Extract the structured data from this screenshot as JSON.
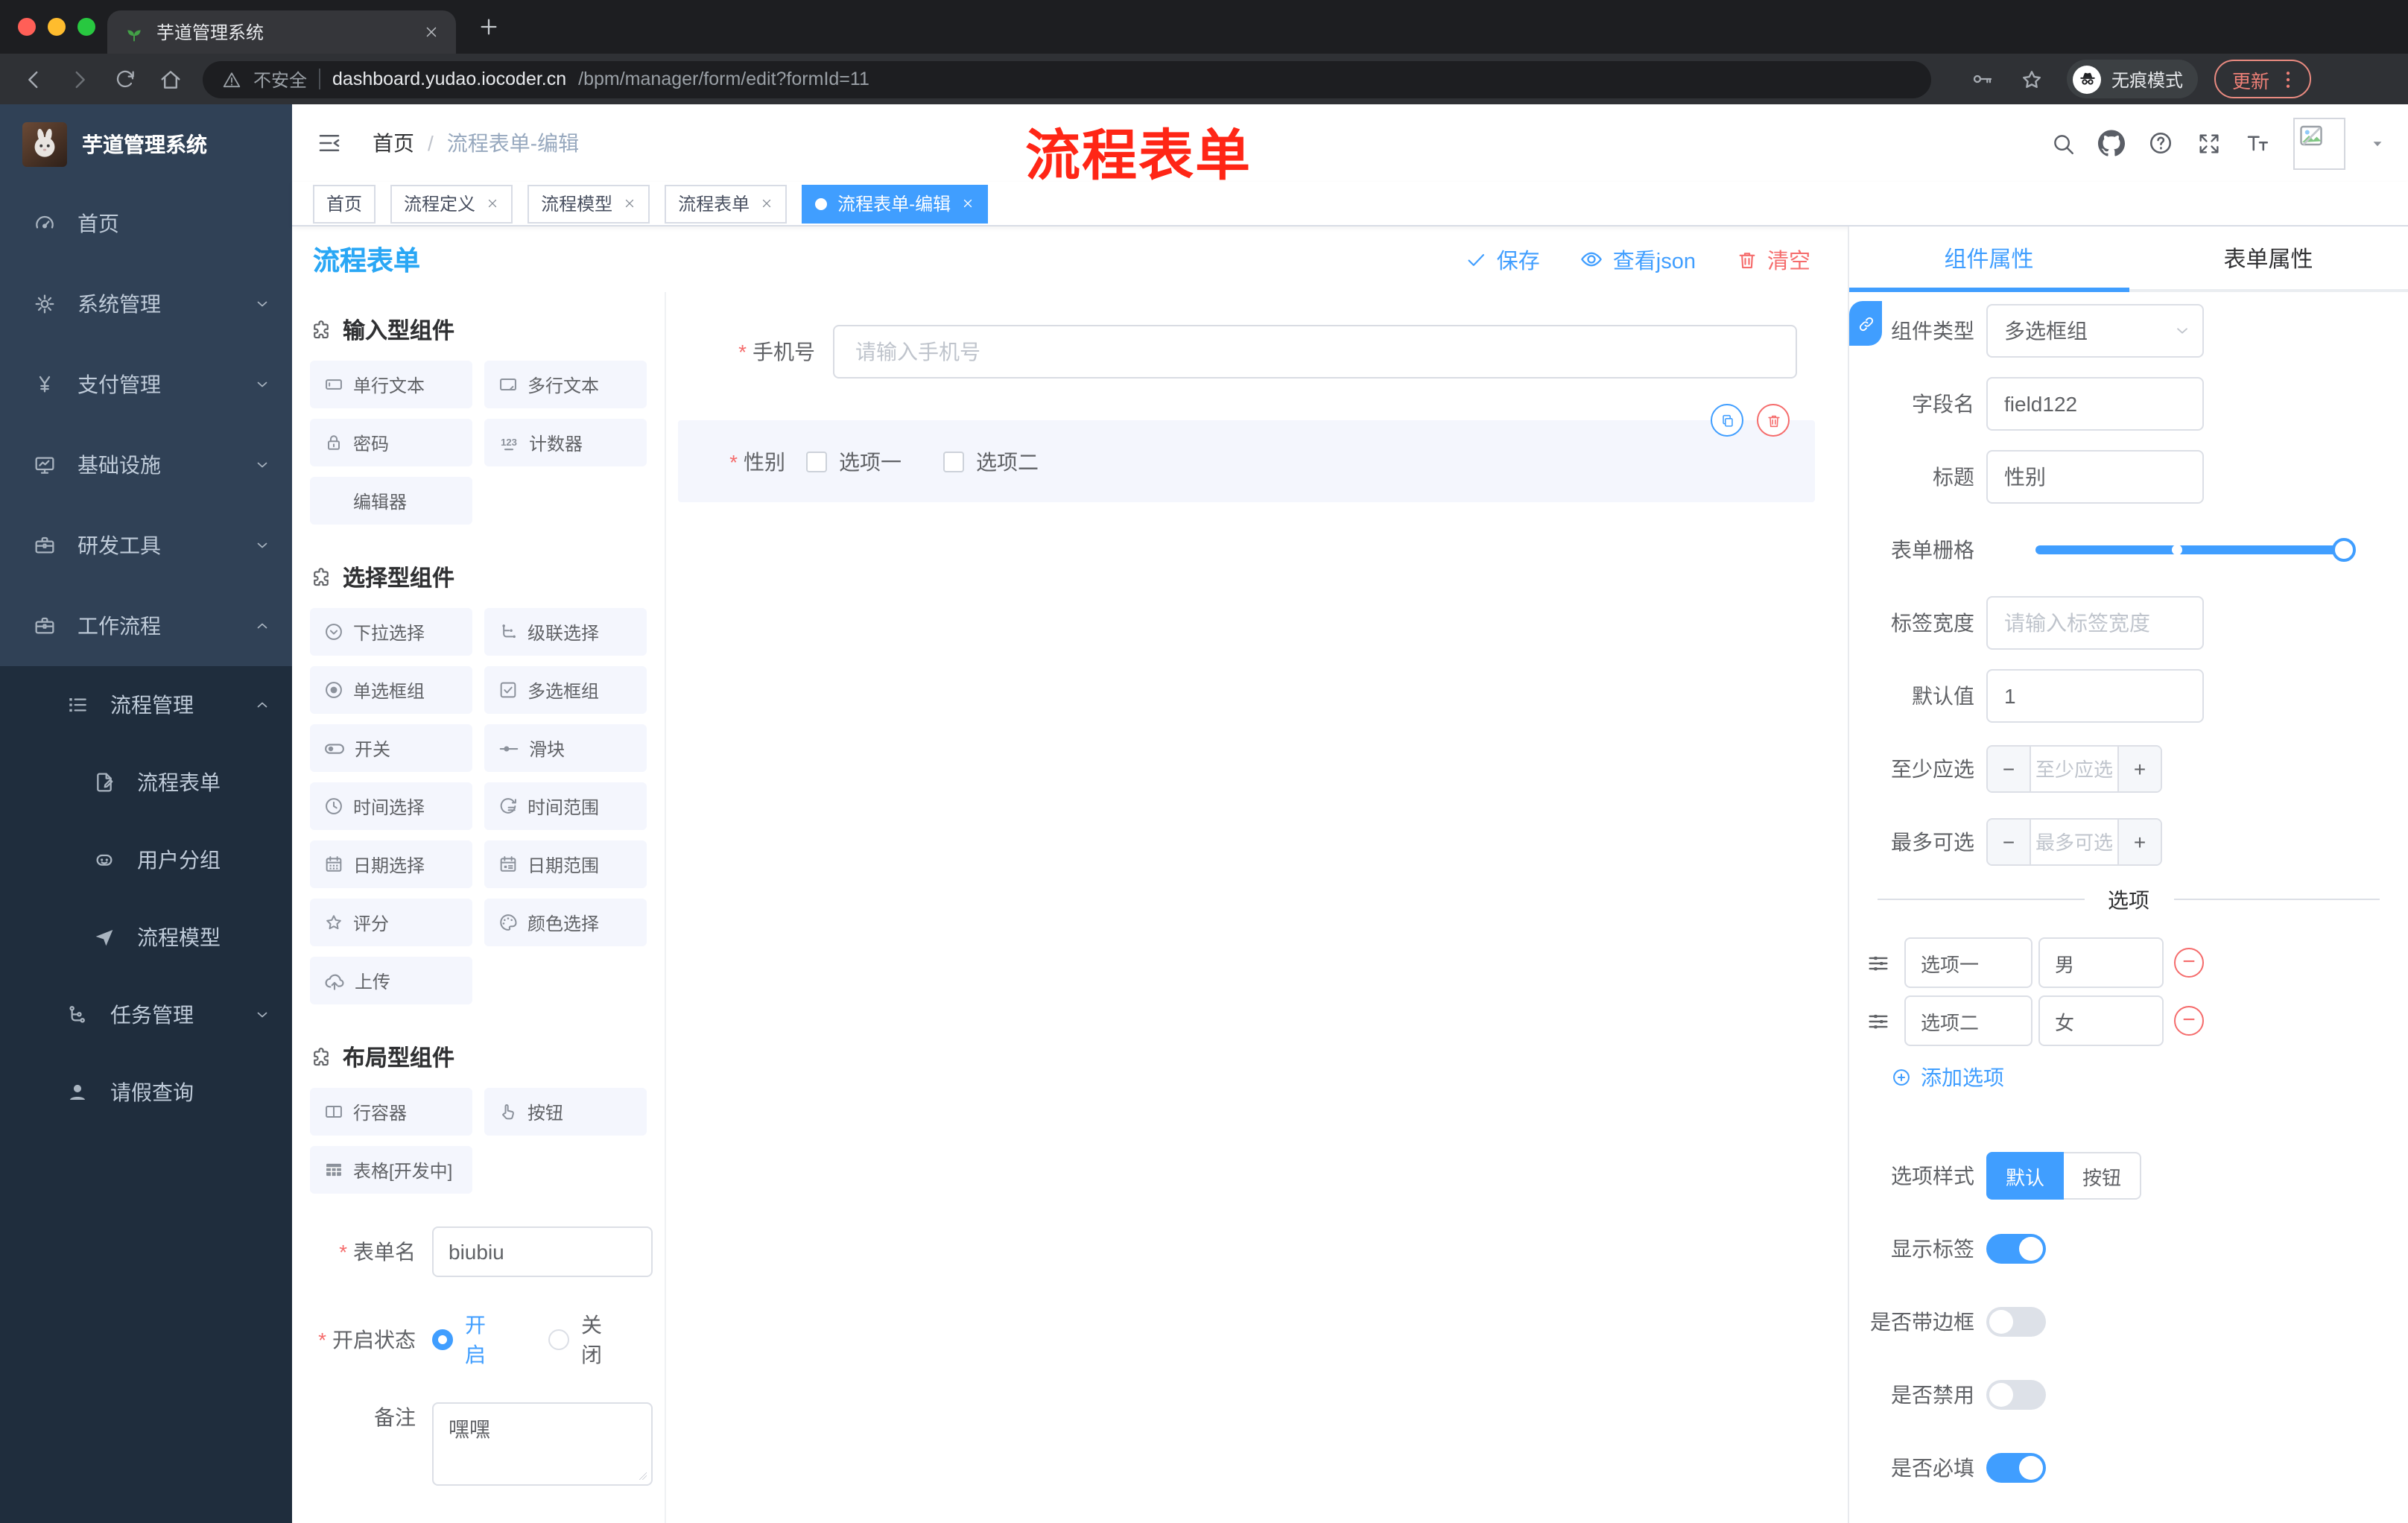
{
  "colors": {
    "accent": "#409eff",
    "danger": "#f56c6c",
    "title_blue": "#2aa7f5",
    "sidebar_bg": "#304156",
    "submenu_bg": "#1f2d3d",
    "annotation_red": "#ff2616"
  },
  "browser": {
    "tab_title": "芋道管理系统",
    "security_label": "不安全",
    "url_host": "dashboard.yudao.iocoder.cn",
    "url_path": "/bpm/manager/form/edit?formId=11",
    "incognito_label": "无痕模式",
    "update_label": "更新"
  },
  "appbar": {
    "breadcrumb_home": "首页",
    "breadcrumb_separator": "/",
    "breadcrumb_current": "流程表单-编辑",
    "annotation": "流程表单"
  },
  "sidebar": {
    "logo_title": "芋道管理系统",
    "items": [
      {
        "label": "首页"
      },
      {
        "label": "系统管理"
      },
      {
        "label": "支付管理"
      },
      {
        "label": "基础设施"
      },
      {
        "label": "研发工具"
      },
      {
        "label": "工作流程"
      }
    ],
    "submenu": [
      {
        "label": "流程管理"
      },
      {
        "label": "流程表单"
      },
      {
        "label": "用户分组"
      },
      {
        "label": "流程模型"
      },
      {
        "label": "任务管理"
      },
      {
        "label": "请假查询"
      }
    ]
  },
  "tags": {
    "items": [
      {
        "label": "首页"
      },
      {
        "label": "流程定义"
      },
      {
        "label": "流程模型"
      },
      {
        "label": "流程表单"
      },
      {
        "label": "流程表单-编辑"
      }
    ]
  },
  "designer": {
    "title": "流程表单",
    "actions": {
      "save": "保存",
      "view_json": "查看json",
      "clear": "清空"
    },
    "palette": {
      "sections": [
        {
          "title": "输入型组件",
          "items": [
            "单行文本",
            "多行文本",
            "密码",
            "计数器",
            "编辑器"
          ]
        },
        {
          "title": "选择型组件",
          "items": [
            "下拉选择",
            "级联选择",
            "单选框组",
            "多选框组",
            "开关",
            "滑块",
            "时间选择",
            "时间范围",
            "日期选择",
            "日期范围",
            "评分",
            "颜色选择",
            "上传"
          ]
        },
        {
          "title": "布局型组件",
          "items": [
            "行容器",
            "按钮",
            "表格[开发中]"
          ]
        }
      ]
    },
    "meta": {
      "name_label": "表单名",
      "name_value": "biubiu",
      "status_label": "开启状态",
      "status_on": "开启",
      "status_off": "关闭",
      "remark_label": "备注",
      "remark_value": "嘿嘿"
    },
    "canvas": {
      "phone_label": "手机号",
      "phone_placeholder": "请输入手机号",
      "gender_label": "性别",
      "gender_opt1": "选项一",
      "gender_opt2": "选项二"
    }
  },
  "props": {
    "tab_component": "组件属性",
    "tab_form": "表单属性",
    "type_label": "组件类型",
    "type_value": "多选框组",
    "field_label": "字段名",
    "field_value": "field122",
    "title_label": "标题",
    "title_value": "性别",
    "grid_label": "表单栅格",
    "width_label": "标签宽度",
    "width_placeholder": "请输入标签宽度",
    "default_label": "默认值",
    "default_value": "1",
    "min_label": "至少应选",
    "min_placeholder": "至少应选",
    "max_label": "最多可选",
    "max_placeholder": "最多可选",
    "options_divider": "选项",
    "options": [
      {
        "label": "选项一",
        "value": "男"
      },
      {
        "label": "选项二",
        "value": "女"
      }
    ],
    "add_option": "添加选项",
    "style_label": "选项样式",
    "style_default": "默认",
    "style_button": "按钮",
    "show_label": "显示标签",
    "border_label": "是否带边框",
    "disabled_label": "是否禁用",
    "required_label": "是否必填"
  },
  "icon_names": [
    "search-icon",
    "github-icon",
    "help-icon",
    "fullscreen-icon",
    "font-size-icon",
    "hamburger-icon",
    "save-check-icon",
    "eye-icon",
    "trash-icon",
    "copy-icon",
    "link-icon",
    "drag-handle-icon",
    "minus-circle-icon",
    "plus-circle-icon",
    "incognito-icon",
    "key-icon",
    "star-icon",
    "warning-icon",
    "puzzle-icon"
  ]
}
